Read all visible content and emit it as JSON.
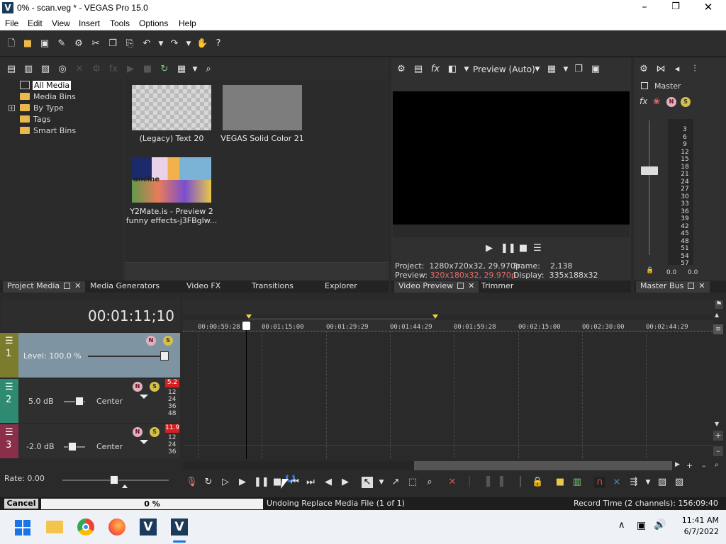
{
  "window": {
    "title": "0% - scan.veg * - VEGAS Pro 15.0",
    "app_icon": "V"
  },
  "menu": [
    "File",
    "Edit",
    "View",
    "Insert",
    "Tools",
    "Options",
    "Help"
  ],
  "project_media": {
    "tree": [
      "All Media",
      "Media Bins",
      "By Type",
      "Tags",
      "Smart Bins"
    ],
    "items": [
      {
        "label": "(Legacy) Text 20"
      },
      {
        "label": "VEGAS Solid Color 21"
      },
      {
        "label_line1": "Y2Mate.is - Preview 2",
        "label_line2": "funny effects-j3FBglw..."
      }
    ],
    "thumb_text": "ancine"
  },
  "dock_tabs_left": {
    "project_media": "Project Media",
    "media_generators": "Media Generators",
    "video_fx": "Video FX",
    "transitions": "Transitions",
    "explorer": "Explorer"
  },
  "preview": {
    "mode": "Preview (Auto)",
    "project_label": "Project:",
    "project_value": "1280x720x32, 29.970p",
    "frame_label": "Frame:",
    "frame_value": "2,138",
    "preview_label": "Preview:",
    "preview_value": "320x180x32, 29.970p",
    "display_label": "Display:",
    "display_value": "335x188x32",
    "tab_video_preview": "Video Preview",
    "tab_trimmer": "Trimmer"
  },
  "master": {
    "label": "Master",
    "meter_labels": [
      "3",
      "6",
      "9",
      "12",
      "15",
      "18",
      "21",
      "24",
      "27",
      "30",
      "33",
      "36",
      "39",
      "42",
      "45",
      "48",
      "51",
      "54",
      "57"
    ],
    "left_value": "0.0",
    "right_value": "0.0",
    "tab": "Master Bus"
  },
  "timeline": {
    "timecode": "00:01:11;10",
    "ruler": [
      "00:00:59:28",
      "00:01:15:00",
      "00:01:29:29",
      "00:01:44:29",
      "00:01:59:28",
      "00:02:15:00",
      "00:02:30:00",
      "00:02:44:29"
    ],
    "tracks": [
      {
        "num": "1",
        "level": "Level: 100.0 %"
      },
      {
        "num": "2",
        "volume": "5.0 dB",
        "pan": "Center",
        "peak": "5.2",
        "scale": [
          "12",
          "24",
          "36",
          "48"
        ]
      },
      {
        "num": "3",
        "volume": "-2.0 dB",
        "pan": "Center",
        "peak": "11.9",
        "scale": [
          "12",
          "24",
          "36"
        ]
      }
    ],
    "rate": "Rate: 0.00"
  },
  "status": {
    "cancel": "Cancel",
    "progress": "0 %",
    "progress_value": 0,
    "message": "Undoing Replace Media File (1 of 1)",
    "record_time": "Record Time (2 channels): 156:09:40"
  },
  "taskbar": {
    "time": "11:41 AM",
    "date": "6/7/2022"
  },
  "colors": {
    "accent": "#3a78d6",
    "track1": "#8a8a3a",
    "track2": "#2e8a70",
    "track3": "#8a2e4a",
    "peak": "#d42020"
  }
}
